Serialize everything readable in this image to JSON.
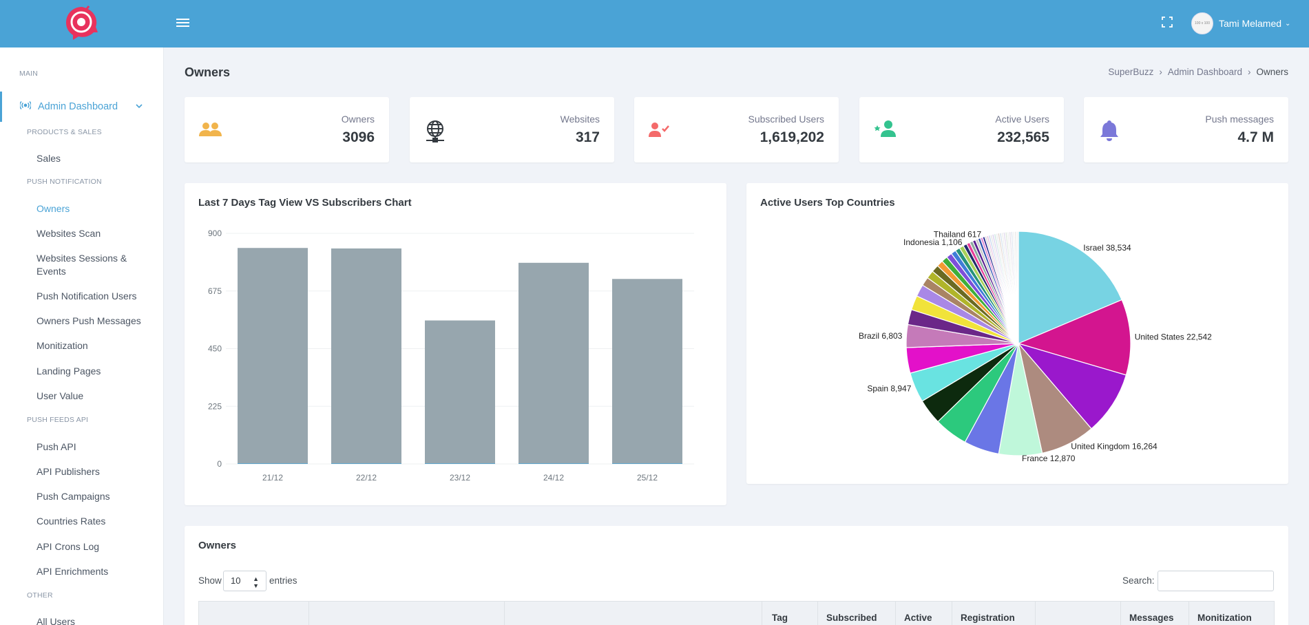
{
  "topbar": {
    "user_name": "Tami Melamed",
    "avatar_text": "100 x 100"
  },
  "sidebar": {
    "main_title": "MAIN",
    "admin_dashboard": "Admin Dashboard",
    "sections": [
      {
        "title": "PRODUCTS & SALES",
        "items": [
          "Sales"
        ]
      },
      {
        "title": "PUSH NOTIFICATION",
        "items": [
          "Owners",
          "Websites Scan",
          "Websites Sessions & Events",
          "Push Notification Users",
          "Owners Push Messages",
          "Monitization",
          "Landing Pages",
          "User Value"
        ]
      },
      {
        "title": "PUSH FEEDS API",
        "items": [
          "Push API",
          "API Publishers",
          "Push Campaigns",
          "Countries Rates",
          "API Crons Log",
          "API Enrichments"
        ]
      },
      {
        "title": "OTHER",
        "items": [
          "All Users"
        ]
      }
    ]
  },
  "page": {
    "title": "Owners",
    "breadcrumb": [
      "SuperBuzz",
      "Admin Dashboard",
      "Owners"
    ]
  },
  "stats": [
    {
      "label": "Owners",
      "value": "3096",
      "icon": "users-icon",
      "color": "#f1b44c"
    },
    {
      "label": "Websites",
      "value": "317",
      "icon": "globe-network-icon",
      "color": "#343a40"
    },
    {
      "label": "Subscribed Users",
      "value": "1,619,202",
      "icon": "user-check-icon",
      "color": "#f46a6a"
    },
    {
      "label": "Active Users",
      "value": "232,565",
      "icon": "user-plus-icon",
      "color": "#34c38f"
    },
    {
      "label": "Push messages",
      "value": "4.7 M",
      "icon": "bell-icon",
      "color": "#7b78d9"
    }
  ],
  "bar_card": {
    "title": "Last 7 Days Tag View VS Subscribers Chart"
  },
  "pie_card": {
    "title": "Active Users Top Countries"
  },
  "chart_data": [
    {
      "type": "bar",
      "title": "Last 7 Days Tag View VS Subscribers Chart",
      "categories": [
        "21/12",
        "22/12",
        "23/12",
        "24/12",
        "25/12"
      ],
      "series": [
        {
          "values": [
            843,
            841,
            560,
            785,
            722
          ],
          "color": "#97a6ae"
        },
        {
          "values": [
            2,
            2,
            2,
            2,
            2
          ],
          "color": "#4aa3d6"
        }
      ],
      "ylim": [
        0,
        900
      ],
      "yticks": [
        0,
        225,
        450,
        675,
        900
      ],
      "grid": true
    },
    {
      "type": "pie",
      "title": "Active Users Top Countries",
      "labeled": [
        {
          "label": "Israel",
          "value": 38534,
          "text": "Israel 38,534",
          "color": "#77d3e3"
        },
        {
          "label": "United States",
          "value": 22542,
          "text": "United States 22,542",
          "color": "#d3158f"
        },
        {
          "label": "",
          "value": 19000,
          "text": "",
          "color": "#9a18cc"
        },
        {
          "label": "United Kingdom",
          "value": 16264,
          "text": "United Kingdom 16,264",
          "color": "#ad8b7f"
        },
        {
          "label": "France",
          "value": 12870,
          "text": "France 12,870",
          "color": "#bff7da"
        },
        {
          "label": "",
          "value": 10500,
          "text": "",
          "color": "#6a76e6"
        },
        {
          "label": "",
          "value": 10000,
          "text": "",
          "color": "#2cc97d"
        },
        {
          "label": "",
          "value": 7600,
          "text": "",
          "color": "#0d2a0e"
        },
        {
          "label": "Spain",
          "value": 8947,
          "text": "Spain 8,947",
          "color": "#69e3e1"
        },
        {
          "label": "",
          "value": 7600,
          "text": "",
          "color": "#e311c9"
        },
        {
          "label": "Brazil",
          "value": 6803,
          "text": "Brazil 6,803",
          "color": "#c57ab9"
        },
        {
          "label": "",
          "value": 4500,
          "text": "",
          "color": "#6b2788"
        },
        {
          "label": "",
          "value": 4300,
          "text": "",
          "color": "#f1e33a"
        },
        {
          "label": "",
          "value": 3600,
          "text": "",
          "color": "#a988e6"
        },
        {
          "label": "",
          "value": 2600,
          "text": "",
          "color": "#a98464"
        },
        {
          "label": "",
          "value": 2400,
          "text": "",
          "color": "#b0b52a"
        },
        {
          "label": "",
          "value": 2200,
          "text": "",
          "color": "#6b6a22"
        },
        {
          "label": "",
          "value": 1900,
          "text": "",
          "color": "#f29a33"
        },
        {
          "label": "",
          "value": 1800,
          "text": "",
          "color": "#3fae3a"
        },
        {
          "label": "",
          "value": 1700,
          "text": "",
          "color": "#7d4fd9"
        },
        {
          "label": "",
          "value": 1500,
          "text": "",
          "color": "#3f7dd8"
        },
        {
          "label": "",
          "value": 1400,
          "text": "",
          "color": "#26927b"
        },
        {
          "label": "",
          "value": 1300,
          "text": "",
          "color": "#a7d15a"
        },
        {
          "label": "Indonesia",
          "value": 1106,
          "text": "Indonesia 1,106",
          "color": "#222c6b"
        },
        {
          "label": "",
          "value": 1000,
          "text": "",
          "color": "#e63c99"
        },
        {
          "label": "",
          "value": 950,
          "text": "",
          "color": "#8ca9a0"
        },
        {
          "label": "",
          "value": 880,
          "text": "",
          "color": "#5a1f91"
        },
        {
          "label": "",
          "value": 800,
          "text": "",
          "color": "#c9c9c9"
        },
        {
          "label": "",
          "value": 760,
          "text": "",
          "color": "#2d4fb0"
        },
        {
          "label": "",
          "value": 700,
          "text": "",
          "color": "#e08bd3"
        },
        {
          "label": "Thailand",
          "value": 617,
          "text": "Thailand 617",
          "color": "#1b1b8a"
        }
      ],
      "tail_colors": [
        "#d9d9d9",
        "#e8c3e0",
        "#c9d9f0",
        "#e6e6e6",
        "#dcd2f0",
        "#cfe7e4",
        "#ededed",
        "#e2d6cf",
        "#d7e3ee",
        "#eeeeee",
        "#e4dcef",
        "#dfe9df",
        "#f0f0f0",
        "#e6e0ea",
        "#e0e6f0",
        "#f2f2f2",
        "#e9e9e9",
        "#f3f3f3"
      ]
    }
  ],
  "table": {
    "title": "Owners",
    "show_label": "Show",
    "entries_value": "10",
    "entries_label": "entries",
    "search_label": "Search:",
    "columns": [
      "Tag",
      "Subscribed",
      "Active",
      "Registration",
      "Messages",
      "Monitization"
    ]
  }
}
